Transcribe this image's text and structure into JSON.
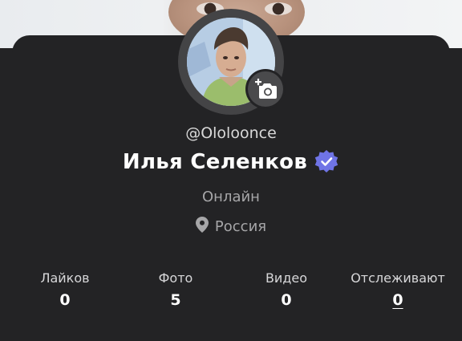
{
  "profile": {
    "username": "@Ololoonce",
    "full_name": "Илья Селенков",
    "verified": true,
    "status": "Онлайн",
    "location": "Россия"
  },
  "stats": [
    {
      "label": "Лайков",
      "value": "0"
    },
    {
      "label": "Фото",
      "value": "5"
    },
    {
      "label": "Видео",
      "value": "0"
    },
    {
      "label": "Отслеживают",
      "value": "0"
    }
  ],
  "icons": {
    "verified": "verified-badge-icon",
    "location": "location-pin-icon",
    "camera": "add-photo-camera-icon"
  },
  "colors": {
    "background": "#232325",
    "verified_badge": "#6f74e6",
    "secondary_text": "#a6a6a8"
  }
}
